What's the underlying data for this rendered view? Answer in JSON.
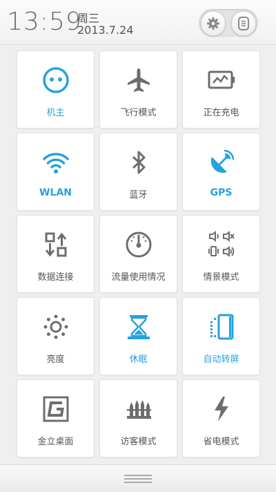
{
  "status": {
    "time": "13:59",
    "weekday": "周三",
    "date": "2013.7.24"
  },
  "header_buttons": [
    {
      "icon": "gear-icon"
    },
    {
      "icon": "menu-icon"
    }
  ],
  "accent_color": "#26a2dd",
  "inactive_color": "#6d6d6d",
  "tiles": [
    {
      "label": "机主",
      "icon": "owner-face-icon",
      "active": true
    },
    {
      "label": "飞行模式",
      "icon": "airplane-icon",
      "active": false
    },
    {
      "label": "正在充电",
      "icon": "battery-charging-icon",
      "active": false
    },
    {
      "label": "WLAN",
      "icon": "wifi-icon",
      "active": true
    },
    {
      "label": "蓝牙",
      "icon": "bluetooth-icon",
      "active": false
    },
    {
      "label": "GPS",
      "icon": "gps-satellite-icon",
      "active": true
    },
    {
      "label": "数据连接",
      "icon": "data-connection-icon",
      "active": false
    },
    {
      "label": "流量使用情况",
      "icon": "gauge-icon",
      "active": false
    },
    {
      "label": "情景模式",
      "icon": "sound-profile-icon",
      "active": false
    },
    {
      "label": "亮度",
      "icon": "brightness-icon",
      "active": false
    },
    {
      "label": "休眠",
      "icon": "hourglass-icon",
      "active": true
    },
    {
      "label": "自动转屏",
      "icon": "auto-rotate-icon",
      "active": true
    },
    {
      "label": "金立桌面",
      "icon": "gionee-launcher-icon",
      "active": false
    },
    {
      "label": "访客模式",
      "icon": "guest-mode-icon",
      "active": false
    },
    {
      "label": "省电模式",
      "icon": "power-saving-icon",
      "active": false
    }
  ]
}
